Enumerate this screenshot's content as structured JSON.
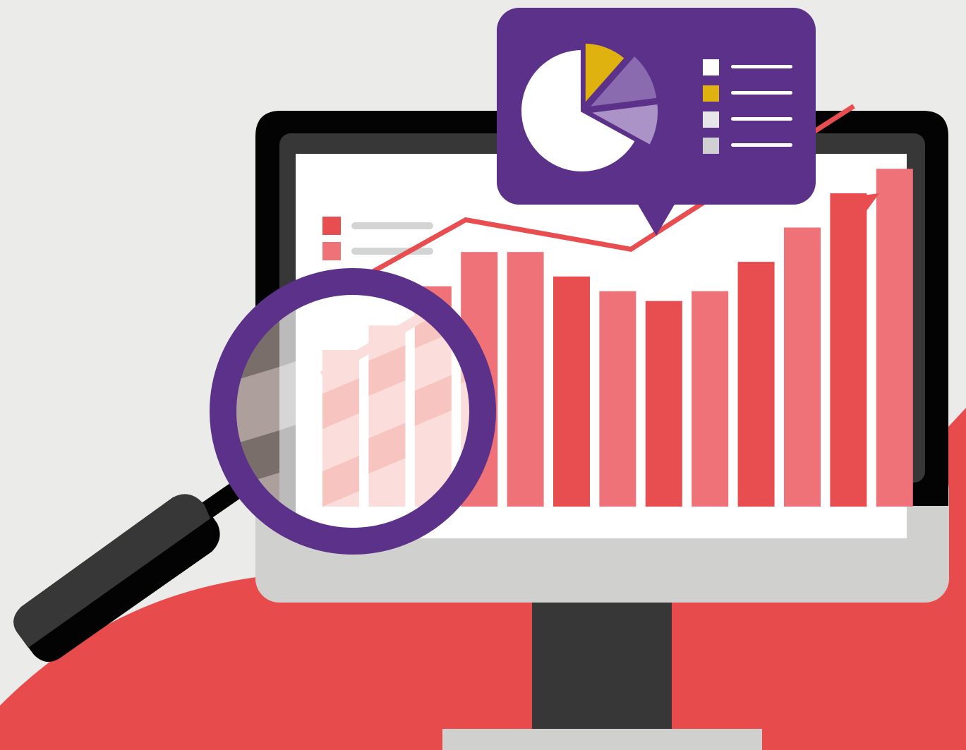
{
  "colors": {
    "background": "#ebebea",
    "ground_red": "#e84b4c",
    "monitor_bezel": "#030303",
    "monitor_inner": "#373737",
    "monitor_chin": "#d0d0cf",
    "stand": "#373737",
    "screen": "#ffffff",
    "bar_dark": "#e84d50",
    "bar_light": "#ee7277",
    "trend_line": "#e84d50",
    "legend_line": "#d3d4d4",
    "bubble": "#5b3189",
    "pie_main": "#ffffff",
    "pie_yellow": "#e0b20f",
    "pie_purple_mid": "#8a6bb0",
    "pie_purple_light": "#ab93c7",
    "bubble_legend_swatch_3": "#e7e7eb",
    "bubble_legend_swatch_4": "#d0d0d2",
    "magnifier_ring": "#5b3189",
    "magnifier_handle": "#373737",
    "lens_bar_light": "#fbdedb",
    "lens_bar_mid": "#f8c4bf"
  },
  "chart_data": {
    "type": "bar",
    "bars": [
      {
        "value": 32,
        "tone": "light"
      },
      {
        "value": 37,
        "tone": "light"
      },
      {
        "value": 45,
        "tone": "light"
      },
      {
        "value": 52,
        "tone": "light"
      },
      {
        "value": 52,
        "tone": "light"
      },
      {
        "value": 47,
        "tone": "dark"
      },
      {
        "value": 44,
        "tone": "light"
      },
      {
        "value": 42,
        "tone": "dark"
      },
      {
        "value": 44,
        "tone": "light"
      },
      {
        "value": 50,
        "tone": "dark"
      },
      {
        "value": 57,
        "tone": "light"
      },
      {
        "value": 64,
        "tone": "dark"
      },
      {
        "value": 69,
        "tone": "light"
      }
    ],
    "trend": [
      34,
      53,
      46,
      80
    ],
    "legend": [
      {
        "color": "#e84d50"
      },
      {
        "color": "#ee7277"
      }
    ],
    "ylim": [
      0,
      100
    ]
  },
  "bubble_pie": {
    "slices": [
      {
        "value": 11.5,
        "color": "#e0b20f"
      },
      {
        "value": 11.5,
        "color": "#8a6bb0"
      },
      {
        "value": 10,
        "color": "#ab93c7"
      },
      {
        "value": 67,
        "color": "#ffffff"
      }
    ],
    "legend": [
      {
        "color": "#ffffff"
      },
      {
        "color": "#e0b20f"
      },
      {
        "color": "#e7e7eb"
      },
      {
        "color": "#d0d0d2"
      }
    ]
  }
}
